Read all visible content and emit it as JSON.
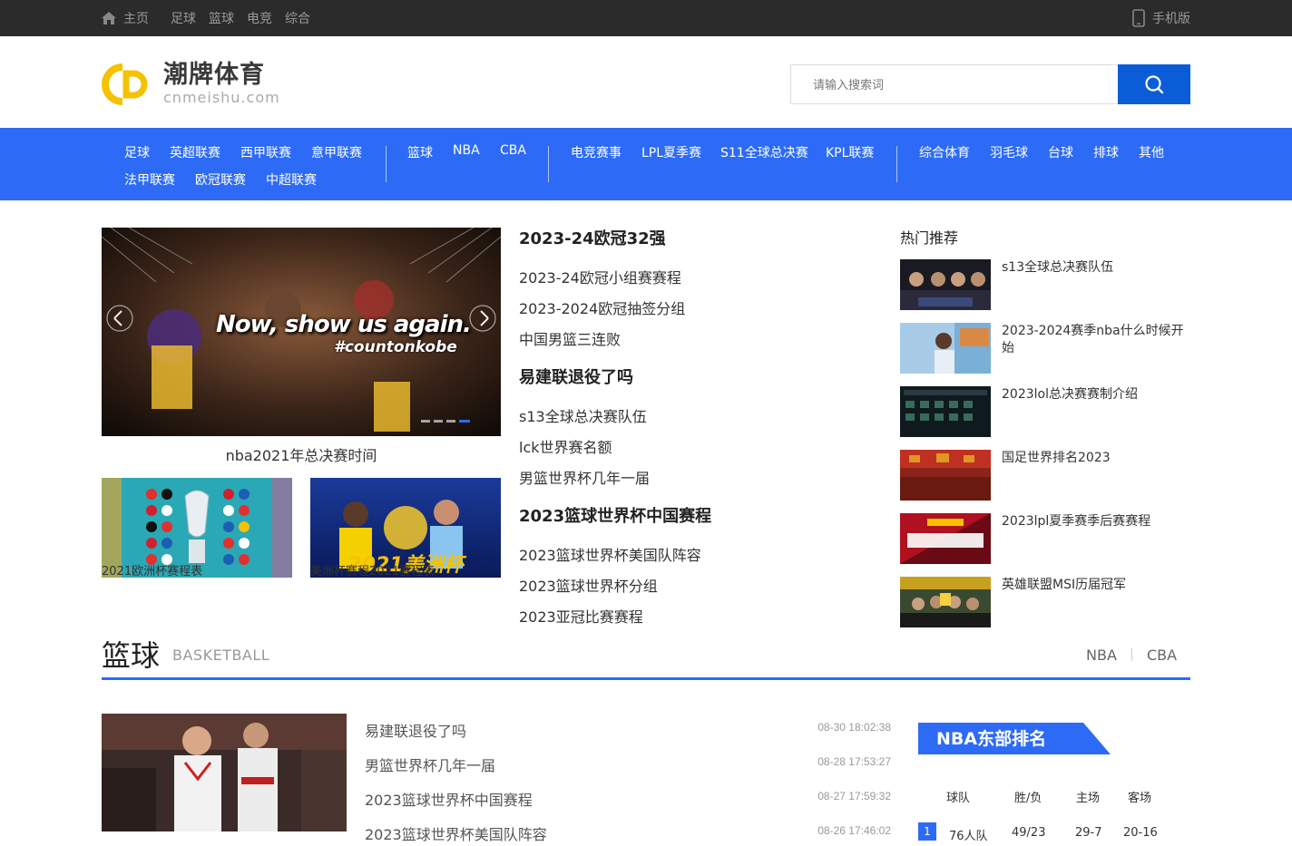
{
  "topbar": {
    "home": "主页",
    "links": [
      "足球",
      "篮球",
      "电竞",
      "综合"
    ],
    "mobile": "手机版"
  },
  "brand": {
    "name": "潮牌体育",
    "domain": "cnmeishu.com",
    "colors": {
      "yellow": "#f5c200",
      "blue": "#2d6bf6",
      "dark_blue": "#0b5dd7"
    }
  },
  "search": {
    "placeholder": "请输入搜索词"
  },
  "nav": {
    "group1_row1": [
      "足球",
      "英超联赛",
      "西甲联赛",
      "意甲联赛"
    ],
    "group1_row2": [
      "法甲联赛",
      "欧冠联赛",
      "中超联赛"
    ],
    "group2": [
      "篮球",
      "NBA",
      "CBA"
    ],
    "group3": [
      "电竞赛事",
      "LPL夏季赛",
      "S11全球总决赛",
      "KPL联赛"
    ],
    "group4": [
      "综合体育",
      "羽毛球",
      "台球",
      "排球",
      "其他"
    ]
  },
  "slider": {
    "caption": "nba2021年总决赛时间",
    "overlay_line1": "Now, show us again.",
    "overlay_line2": "#countonkobe"
  },
  "thumbs": [
    {
      "caption": "2021欧洲杯赛程表"
    },
    {
      "caption": "美洲杯赛程2021赛程表",
      "image_text": "2021美洲杯"
    }
  ],
  "mid": [
    {
      "title": "2023-24欧冠32强",
      "items": [
        "2023-24欧冠小组赛赛程",
        "2023-2024欧冠抽签分组",
        "中国男篮三连败"
      ]
    },
    {
      "title": "易建联退役了吗",
      "items": [
        "s13全球总决赛队伍",
        "lck世界赛名额",
        "男篮世界杯几年一届"
      ]
    },
    {
      "title": "2023篮球世界杯中国赛程",
      "items": [
        "2023篮球世界杯美国队阵容",
        "2023篮球世界杯分组",
        "2023亚冠比赛赛程"
      ]
    }
  ],
  "hot": {
    "title": "热门推荐",
    "items": [
      {
        "text": "s13全球总决赛队伍"
      },
      {
        "text": "2023-2024赛季nba什么时候开始"
      },
      {
        "text": "2023lol总决赛赛制介绍"
      },
      {
        "text": "国足世界排名2023"
      },
      {
        "text": "2023lpl夏季赛季后赛赛程"
      },
      {
        "text": "英雄联盟MSI历届冠军"
      }
    ]
  },
  "basketball": {
    "title": "篮球",
    "title_en": "BASKETBALL",
    "tabs": [
      "NBA",
      "CBA"
    ],
    "news": [
      {
        "title": "易建联退役了吗",
        "date": "08-30 18:02:38"
      },
      {
        "title": "男篮世界杯几年一届",
        "date": "08-28 17:53:27"
      },
      {
        "title": "2023篮球世界杯中国赛程",
        "date": "08-27 17:59:32"
      },
      {
        "title": "2023篮球世界杯美国队阵容",
        "date": "08-26 17:46:02"
      }
    ]
  },
  "rank": {
    "title": "NBA东部排名",
    "columns": [
      "球队",
      "胜/负",
      "主场",
      "客场"
    ],
    "rows": [
      {
        "no": "1",
        "team": "76人队",
        "wl": "49/23",
        "home": "29-7",
        "away": "20-16"
      }
    ]
  }
}
